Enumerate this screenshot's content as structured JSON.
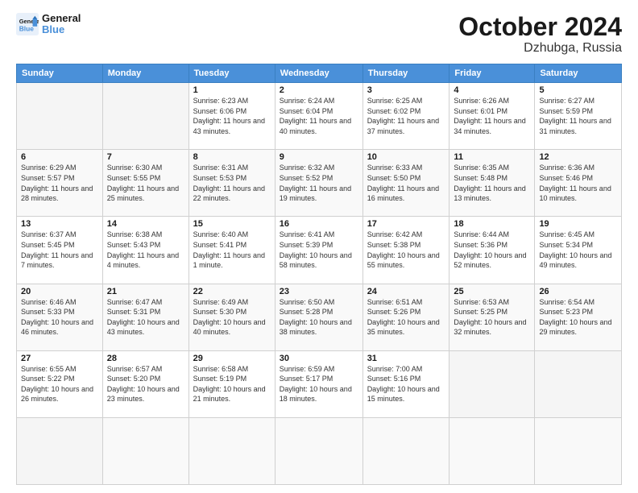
{
  "logo": {
    "line1": "General",
    "line2": "Blue"
  },
  "title": "October 2024",
  "subtitle": "Dzhubga, Russia",
  "weekdays": [
    "Sunday",
    "Monday",
    "Tuesday",
    "Wednesday",
    "Thursday",
    "Friday",
    "Saturday"
  ],
  "days": [
    {
      "num": "",
      "info": ""
    },
    {
      "num": "",
      "info": ""
    },
    {
      "num": "1",
      "info": "Sunrise: 6:23 AM\nSunset: 6:06 PM\nDaylight: 11 hours and 43 minutes."
    },
    {
      "num": "2",
      "info": "Sunrise: 6:24 AM\nSunset: 6:04 PM\nDaylight: 11 hours and 40 minutes."
    },
    {
      "num": "3",
      "info": "Sunrise: 6:25 AM\nSunset: 6:02 PM\nDaylight: 11 hours and 37 minutes."
    },
    {
      "num": "4",
      "info": "Sunrise: 6:26 AM\nSunset: 6:01 PM\nDaylight: 11 hours and 34 minutes."
    },
    {
      "num": "5",
      "info": "Sunrise: 6:27 AM\nSunset: 5:59 PM\nDaylight: 11 hours and 31 minutes."
    },
    {
      "num": "6",
      "info": "Sunrise: 6:29 AM\nSunset: 5:57 PM\nDaylight: 11 hours and 28 minutes."
    },
    {
      "num": "7",
      "info": "Sunrise: 6:30 AM\nSunset: 5:55 PM\nDaylight: 11 hours and 25 minutes."
    },
    {
      "num": "8",
      "info": "Sunrise: 6:31 AM\nSunset: 5:53 PM\nDaylight: 11 hours and 22 minutes."
    },
    {
      "num": "9",
      "info": "Sunrise: 6:32 AM\nSunset: 5:52 PM\nDaylight: 11 hours and 19 minutes."
    },
    {
      "num": "10",
      "info": "Sunrise: 6:33 AM\nSunset: 5:50 PM\nDaylight: 11 hours and 16 minutes."
    },
    {
      "num": "11",
      "info": "Sunrise: 6:35 AM\nSunset: 5:48 PM\nDaylight: 11 hours and 13 minutes."
    },
    {
      "num": "12",
      "info": "Sunrise: 6:36 AM\nSunset: 5:46 PM\nDaylight: 11 hours and 10 minutes."
    },
    {
      "num": "13",
      "info": "Sunrise: 6:37 AM\nSunset: 5:45 PM\nDaylight: 11 hours and 7 minutes."
    },
    {
      "num": "14",
      "info": "Sunrise: 6:38 AM\nSunset: 5:43 PM\nDaylight: 11 hours and 4 minutes."
    },
    {
      "num": "15",
      "info": "Sunrise: 6:40 AM\nSunset: 5:41 PM\nDaylight: 11 hours and 1 minute."
    },
    {
      "num": "16",
      "info": "Sunrise: 6:41 AM\nSunset: 5:39 PM\nDaylight: 10 hours and 58 minutes."
    },
    {
      "num": "17",
      "info": "Sunrise: 6:42 AM\nSunset: 5:38 PM\nDaylight: 10 hours and 55 minutes."
    },
    {
      "num": "18",
      "info": "Sunrise: 6:44 AM\nSunset: 5:36 PM\nDaylight: 10 hours and 52 minutes."
    },
    {
      "num": "19",
      "info": "Sunrise: 6:45 AM\nSunset: 5:34 PM\nDaylight: 10 hours and 49 minutes."
    },
    {
      "num": "20",
      "info": "Sunrise: 6:46 AM\nSunset: 5:33 PM\nDaylight: 10 hours and 46 minutes."
    },
    {
      "num": "21",
      "info": "Sunrise: 6:47 AM\nSunset: 5:31 PM\nDaylight: 10 hours and 43 minutes."
    },
    {
      "num": "22",
      "info": "Sunrise: 6:49 AM\nSunset: 5:30 PM\nDaylight: 10 hours and 40 minutes."
    },
    {
      "num": "23",
      "info": "Sunrise: 6:50 AM\nSunset: 5:28 PM\nDaylight: 10 hours and 38 minutes."
    },
    {
      "num": "24",
      "info": "Sunrise: 6:51 AM\nSunset: 5:26 PM\nDaylight: 10 hours and 35 minutes."
    },
    {
      "num": "25",
      "info": "Sunrise: 6:53 AM\nSunset: 5:25 PM\nDaylight: 10 hours and 32 minutes."
    },
    {
      "num": "26",
      "info": "Sunrise: 6:54 AM\nSunset: 5:23 PM\nDaylight: 10 hours and 29 minutes."
    },
    {
      "num": "27",
      "info": "Sunrise: 6:55 AM\nSunset: 5:22 PM\nDaylight: 10 hours and 26 minutes."
    },
    {
      "num": "28",
      "info": "Sunrise: 6:57 AM\nSunset: 5:20 PM\nDaylight: 10 hours and 23 minutes."
    },
    {
      "num": "29",
      "info": "Sunrise: 6:58 AM\nSunset: 5:19 PM\nDaylight: 10 hours and 21 minutes."
    },
    {
      "num": "30",
      "info": "Sunrise: 6:59 AM\nSunset: 5:17 PM\nDaylight: 10 hours and 18 minutes."
    },
    {
      "num": "31",
      "info": "Sunrise: 7:00 AM\nSunset: 5:16 PM\nDaylight: 10 hours and 15 minutes."
    },
    {
      "num": "",
      "info": ""
    },
    {
      "num": "",
      "info": ""
    },
    {
      "num": "",
      "info": ""
    }
  ]
}
